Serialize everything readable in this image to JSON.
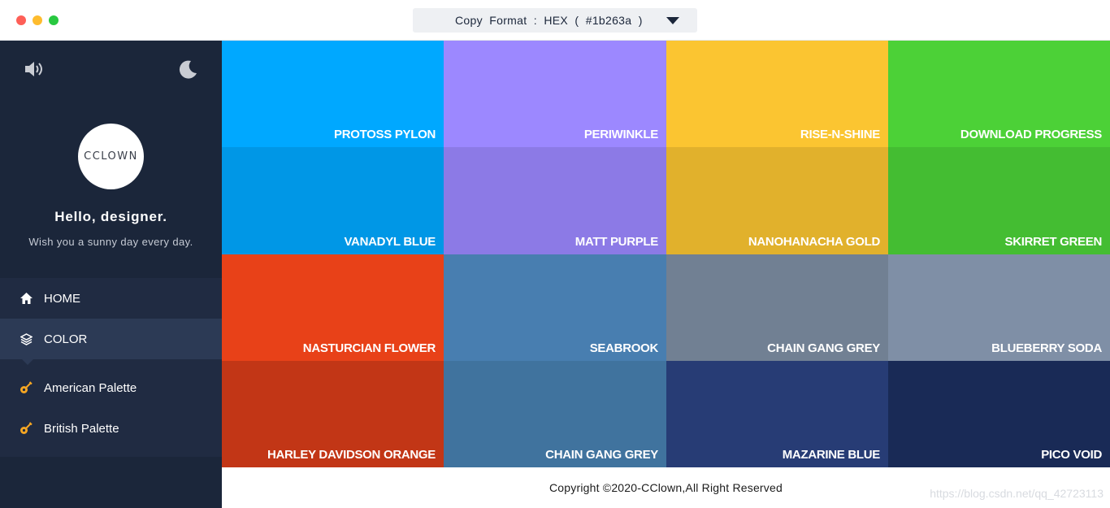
{
  "titlebar": {
    "format_label": "Copy  Format  :  HEX  (  #1b263a  )"
  },
  "sidebar": {
    "avatar_text": "CCLOWN",
    "greeting": "Hello,  designer.",
    "subgreeting": "Wish  you  a  sunny  day  every  day.",
    "nav": {
      "home": "HOME",
      "color": "COLOR",
      "sub_items": [
        "American Palette",
        "British Palette"
      ]
    }
  },
  "colors": [
    {
      "name": "PROTOSS PYLON",
      "hex": "#00a8ff"
    },
    {
      "name": "PERIWINKLE",
      "hex": "#9c88ff"
    },
    {
      "name": "RISE-N-SHINE",
      "hex": "#fbc531"
    },
    {
      "name": "DOWNLOAD PROGRESS",
      "hex": "#4cd137"
    },
    {
      "name": "VANADYL BLUE",
      "hex": "#0097e6"
    },
    {
      "name": "MATT PURPLE",
      "hex": "#8c7ae6"
    },
    {
      "name": "NANOHANACHA GOLD",
      "hex": "#e1b12c"
    },
    {
      "name": "SKIRRET GREEN",
      "hex": "#44bd32"
    },
    {
      "name": "NASTURCIAN FLOWER",
      "hex": "#e84118"
    },
    {
      "name": "SEABROOK",
      "hex": "#487eb0"
    },
    {
      "name": "CHAIN GANG GREY",
      "hex": "#718093"
    },
    {
      "name": "BLUEBERRY SODA",
      "hex": "#7f8fa6"
    },
    {
      "name": "HARLEY DAVIDSON ORANGE",
      "hex": "#c23616"
    },
    {
      "name": "CHAIN GANG GREY",
      "hex": "#40739e"
    },
    {
      "name": "MAZARINE BLUE",
      "hex": "#273c75"
    },
    {
      "name": "PICO VOID",
      "hex": "#192a56"
    }
  ],
  "footer": {
    "copyright": "Copyright  ©2020-CClown,All  Right  Reserved",
    "watermark": "https://blog.csdn.net/qq_42723113"
  }
}
